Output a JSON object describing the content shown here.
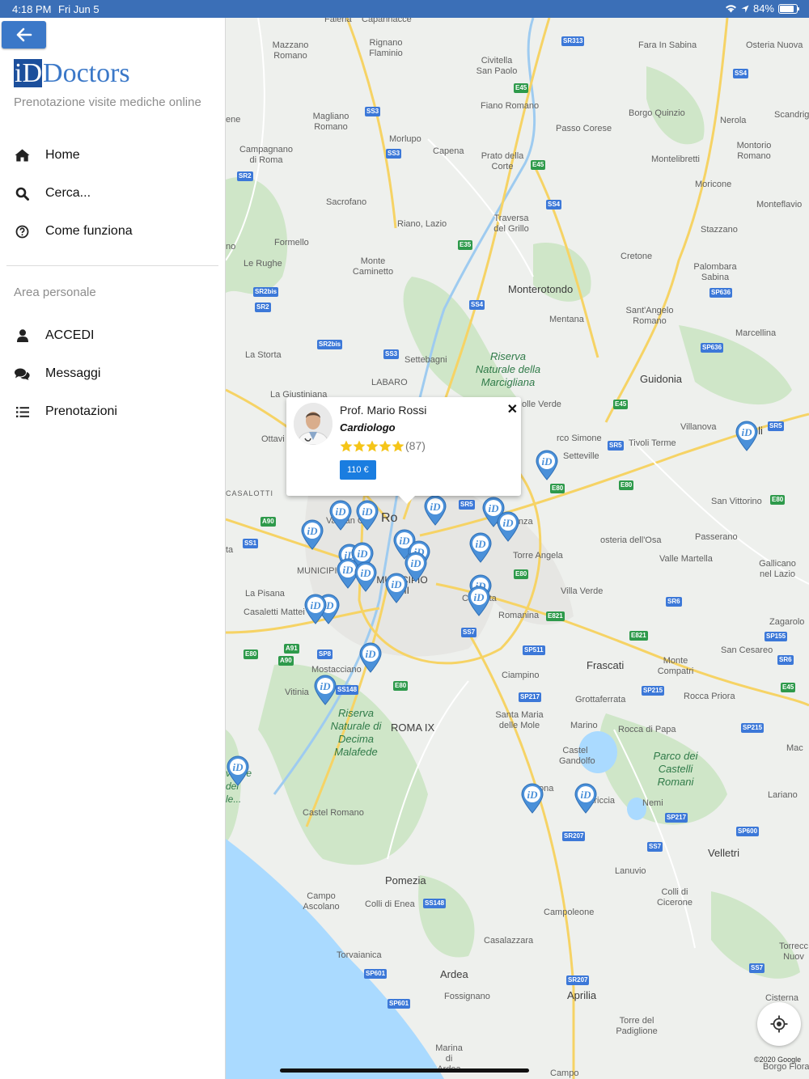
{
  "status_bar": {
    "time": "4:18 PM",
    "date": "Fri Jun 5",
    "battery": "84%",
    "battery_level": 0.84
  },
  "sidebar": {
    "back_icon": "arrow-left-icon",
    "logo_mark": "i",
    "logo_text": "Doctors",
    "logo_mark_full": "D",
    "tagline": "Prenotazione visite mediche online",
    "nav": [
      {
        "label": "Home",
        "icon": "home-icon"
      },
      {
        "label": "Cerca...",
        "icon": "search-icon"
      },
      {
        "label": "Come funziona",
        "icon": "question-circle-icon"
      }
    ],
    "area_label": "Area personale",
    "personal": [
      {
        "label": "ACCEDI",
        "icon": "user-icon"
      },
      {
        "label": "Messaggi",
        "icon": "comments-icon"
      },
      {
        "label": "Prenotazioni",
        "icon": "list-icon"
      }
    ]
  },
  "popup": {
    "name": "Prof. Mario Rossi",
    "specialty": "Cardiologo",
    "rating": 5,
    "rating_count": "(87)",
    "price": "110 €",
    "close": "✕"
  },
  "map": {
    "copyright": "©2020 Google",
    "pin_label": "iD",
    "colors": {
      "pin": "#4a90d9",
      "sidebar_button": "#3b78c8",
      "price_badge": "#1a7de0",
      "star": "#f5c518"
    },
    "places": {
      "faleria": "Faleria",
      "calcata": "Capannacce",
      "mazzano": "Mazzano Romano",
      "rignano": "Rignano Flaminio",
      "civitella": "Civitella San Paolo",
      "fara": "Fara In Sabina",
      "osteria": "Osteria Nuova",
      "magliano": "Magliano Romano",
      "fiano": "Fiano Romano",
      "passo_corese": "Passo Corese",
      "borgo_quinzio": "Borgo Quinzio",
      "nerola": "Nerola",
      "scandriglia": "Scandrig",
      "campagnano": "Campagnano di Roma",
      "morlupo": "Morlupo",
      "capena": "Capena",
      "prato": "Prato della Corte",
      "montelibretti": "Montelibretti",
      "montorio": "Montorio Romano",
      "moricone": "Moricone",
      "sacrofano": "Sacrofano",
      "riano": "Riano, Lazio",
      "traversa": "Traversa del Grillo",
      "monteflavio": "Monteflavio",
      "stazzano": "Stazzano",
      "formello": "Formello",
      "le_rughe": "Le Rughe",
      "monte_caminetto": "Monte Caminetto",
      "cretone": "Cretone",
      "palombara": "Palombara Sabina",
      "monterotondo": "Monterotondo",
      "mentana": "Mentana",
      "santangelo": "Sant'Angelo Romano",
      "marcellina": "Marcellina",
      "la_storta": "La Storta",
      "settebagni": "Settebagni",
      "riserva_marcigliana": "Riserva Naturale della Marcigliana",
      "labaro": "LABARO",
      "guidonia": "Guidonia",
      "la_giustiniana": "La Giustiniana",
      "colle_verde": "olle Verde",
      "villanova": "Villanova",
      "tivoli": "Tivoli",
      "ottavia": "Ottavi",
      "colle_simone": "rco Simone",
      "setteville": "Setteville",
      "tivoli_terme": "Tivoli Terme",
      "casalotti": "CASALOTTI",
      "san_vittorino": "San Vittorino",
      "vatican": "Vatican City",
      "roma": "Ro",
      "sapienza": "r Sapienza",
      "osteria_osa": "osteria dell'Osa",
      "passerano": "Passerano",
      "torre_angela": "Torre Angela",
      "valle_martella": "Valle Martella",
      "gallicano": "Gallicano nel Lazio",
      "municipio_xii": "MUNICIPIO XII",
      "municipio_viii": "MUNICIPIO VIII",
      "la_pisana": "La Pisana",
      "cinecitta": "Cinecitta",
      "villa_verde": "Villa Verde",
      "casaletti": "Casaletti Mattei",
      "romanina": "Romanina",
      "zagarolo": "Zagarolo",
      "san_cesareo": "San Cesareo",
      "monte_compatri": "Monte Compatri",
      "frascati": "Frascati",
      "mostacciano": "Mostacciano",
      "ciampino": "Ciampino",
      "vitinia": "Vitinia",
      "grottaferrata": "Grottaferrata",
      "rocca_priora": "Rocca Priora",
      "santa_maria": "Santa Maria delle Mole",
      "marino": "Marino",
      "rocca_papa": "Rocca di Papa",
      "riserva_decima": "Riserva Naturale di Decima Malafede",
      "roma_ix": "ROMA IX",
      "castel_gandolfo": "Castel Gandolfo",
      "parco_castelli": "Parco dei Castelli Romani",
      "albano": "ona",
      "ariccia": "Ariccia",
      "nemi": "Nemi",
      "lariano": "Lariano",
      "castel_romano": "Castel Romano",
      "velletri": "Velletri",
      "lanuvio": "Lanuvio",
      "pomezia": "Pomezia",
      "colli_cicerone": "Colli di Cicerone",
      "campo_ascolano": "Campo Ascolano",
      "colli_enea": "Colli di Enea",
      "campoleone": "Campoleone",
      "torvaianica": "Torvaianica",
      "casalazzara": "Casalazzara",
      "torrecchia": "Torrecc Nuov",
      "ardea": "Ardea",
      "fossignano": "Fossignano",
      "aprilia": "Aprilia",
      "cisterna": "Cisterna",
      "torre_padiglione": "Torre del Padiglione",
      "marina_ardea": "Marina di Ardea",
      "campo": "Campo",
      "borgo_flora": "Borgo Flora",
      "mac": "Mac",
      "ene": "ene",
      "no": "no",
      "ta": "ta",
      "lake_label": "va ale del le..."
    },
    "shields": {
      "sr313": "SR313",
      "ss4_a": "SS4",
      "ss3_a": "SS3",
      "e45_a": "E45",
      "ss3_b": "SS3",
      "e45_b": "E45",
      "sr2_a": "SR2",
      "ss4_b": "SS4",
      "e35": "E35",
      "sr2bis_a": "SR2bis",
      "sr2_b": "SR2",
      "sp636_a": "SP636",
      "ss4_c": "SS4",
      "sr2bis_b": "SR2bis",
      "ss3_c": "SS3",
      "sp636_b": "SP636",
      "e45_c": "E45",
      "sr5_a": "SR5",
      "sr5_b": "SR5",
      "e80_a": "E80",
      "e80_b": "E80",
      "e80_c": "E80",
      "sr5_c": "SR5",
      "a90_a": "A90",
      "ss1": "SS1",
      "e80_d": "E80",
      "sr6": "SR6",
      "e821_a": "E821",
      "ss7_a": "SS7",
      "e821_b": "E821",
      "sp155": "SP155",
      "a91": "A91",
      "e80_e": "E80",
      "sp8": "SP8",
      "a90_b": "A90",
      "sp511": "SP511",
      "sr6_b": "SR6",
      "ss148_a": "SS148",
      "e80_f": "E80",
      "sp215_a": "SP215",
      "e45_d": "E45",
      "sp217_a": "SP217",
      "sp215_b": "SP215",
      "sp217_b": "SP217",
      "sp600": "SP600",
      "sr207_a": "SR207",
      "ss7_b": "SS7",
      "ss148_b": "SS148",
      "ss7_c": "SS7",
      "sp601_a": "SP601",
      "sr207_b": "SR207",
      "sp601_b": "SP601"
    }
  }
}
